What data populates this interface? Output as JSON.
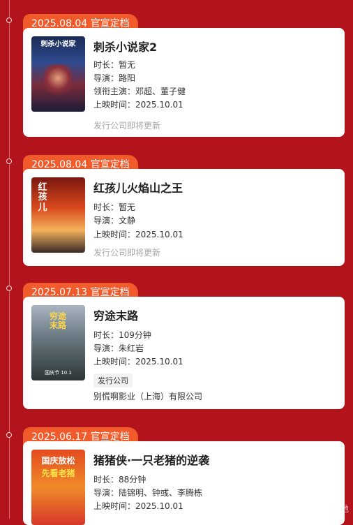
{
  "entries": [
    {
      "badge": "2025.08.04 官宣定档",
      "title": "刺杀小说家2",
      "duration": "时长：暂无",
      "director": "导演：路阳",
      "cast": "领衔主演：邓超、董子健",
      "release": "上映时间：2025.10.01",
      "footer": "发行公司即将更新",
      "poster_text": "刺杀小说家"
    },
    {
      "badge": "2025.08.04 官宣定档",
      "title": "红孩儿火焰山之王",
      "duration": "时长：暂无",
      "director": "导演：文静",
      "release": "上映时间：2025.10.01",
      "footer": "发行公司即将更新",
      "poster_text": "红孩儿"
    },
    {
      "badge": "2025.07.13 官宣定档",
      "title": "穷途末路",
      "duration": "时长：109分钟",
      "director": "导演：朱红岩",
      "release": "上映时间：2025.10.01",
      "publisher_label": "发行公司",
      "publisher": "别慌啊影业（上海）有限公司",
      "poster_text": "穷途末路",
      "poster_subtext": "国庆节 10.1"
    },
    {
      "badge": "2025.06.17 官宣定档",
      "title": "猪猪侠·一只老猪的逆袭",
      "duration": "时长：88分钟",
      "director": "导演：陆锦明、钟彧、李腾栋",
      "release": "上映时间：2025.10.01",
      "poster_text_1": "国庆放松",
      "poster_text_2": "先看老猪"
    }
  ],
  "watermark": "头条号 / 一只三分地",
  "colors": {
    "background": "#b3131a",
    "badge": "#f15a2b",
    "card": "#ffffff"
  }
}
